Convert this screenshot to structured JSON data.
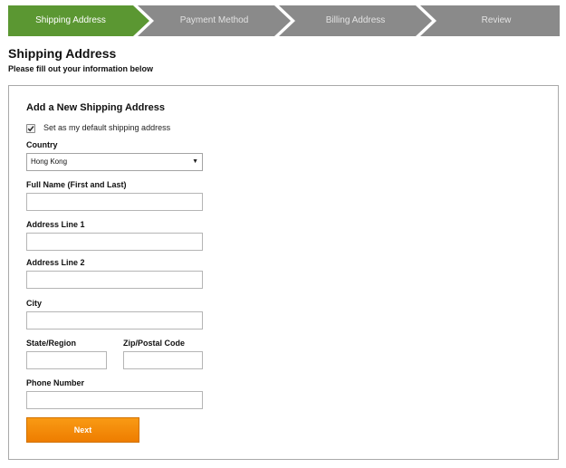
{
  "steps": [
    {
      "label": "Shipping Address",
      "active": true
    },
    {
      "label": "Payment Method",
      "active": false
    },
    {
      "label": "Billing Address",
      "active": false
    },
    {
      "label": "Review",
      "active": false
    }
  ],
  "colors": {
    "active_step": "#5b9732",
    "inactive_step": "#8a8a8a",
    "next_button": "#f08a0a"
  },
  "page": {
    "title": "Shipping Address",
    "subtitle": "Please fill out your information below"
  },
  "form": {
    "title": "Add a New Shipping Address",
    "default_checkbox": {
      "label": "Set as my default shipping address",
      "checked": true
    },
    "country": {
      "label": "Country",
      "value": "Hong Kong"
    },
    "full_name": {
      "label": "Full Name (First and Last)",
      "value": ""
    },
    "address1": {
      "label": "Address Line 1",
      "value": ""
    },
    "address2": {
      "label": "Address Line 2",
      "value": ""
    },
    "city": {
      "label": "City",
      "value": ""
    },
    "state": {
      "label": "State/Region",
      "value": ""
    },
    "zip": {
      "label": "Zip/Postal Code",
      "value": ""
    },
    "phone": {
      "label": "Phone Number",
      "value": ""
    },
    "next_label": "Next"
  }
}
